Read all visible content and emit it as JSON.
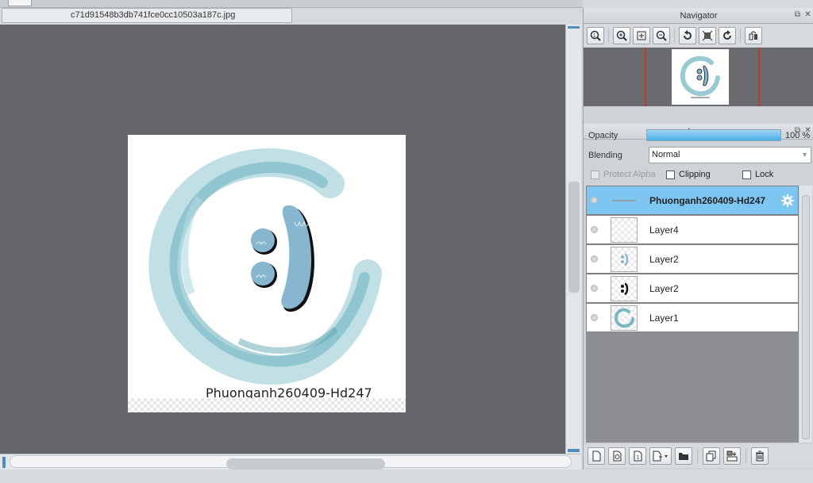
{
  "document": {
    "tab_title": "c71d91548b3db741fce0cc10503a187c.jpg",
    "canvas_caption": "Phuonganh260409-Hd247",
    "colors": {
      "canvas_bg": "#65666a",
      "ink_teal": "#5ba8b8",
      "face_blue": "#86b6d0"
    }
  },
  "navigator": {
    "title": "Navigator",
    "toolbar": [
      "zoom-fit-icon",
      "zoom-in-icon",
      "fit-window-icon",
      "zoom-out-icon",
      "rotate-left-icon",
      "reset-view-icon",
      "rotate-right-icon",
      "flip-icon"
    ]
  },
  "layer_panel": {
    "title": "Layer",
    "opacity_label": "Opacity",
    "opacity_value": "100 %",
    "opacity_fraction": 1.0,
    "blending_label": "Blending",
    "blending_value": "Normal",
    "protect_alpha_label": "Protect Alpha",
    "clipping_label": "Clipping",
    "lock_label": "Lock",
    "layers": [
      {
        "name": "Phuonganh260409-Hd247",
        "selected": true,
        "kind": "text"
      },
      {
        "name": "Layer4",
        "selected": false,
        "kind": "empty"
      },
      {
        "name": "Layer2",
        "selected": false,
        "kind": "face-light"
      },
      {
        "name": "Layer2",
        "selected": false,
        "kind": "face-dark"
      },
      {
        "name": "Layer1",
        "selected": false,
        "kind": "ring"
      }
    ],
    "toolbar": [
      "new-layer-icon",
      "new-halftone-layer-icon",
      "new-1bit-layer-icon",
      "add-layer-dropdown-icon",
      "folder-icon",
      "duplicate-layer-icon",
      "merge-down-icon",
      "delete-layer-icon"
    ]
  },
  "colors": {
    "selected_row": "#7dc6f1",
    "opacity_fill": "#46aee6",
    "accent_red": "#c0392b"
  }
}
